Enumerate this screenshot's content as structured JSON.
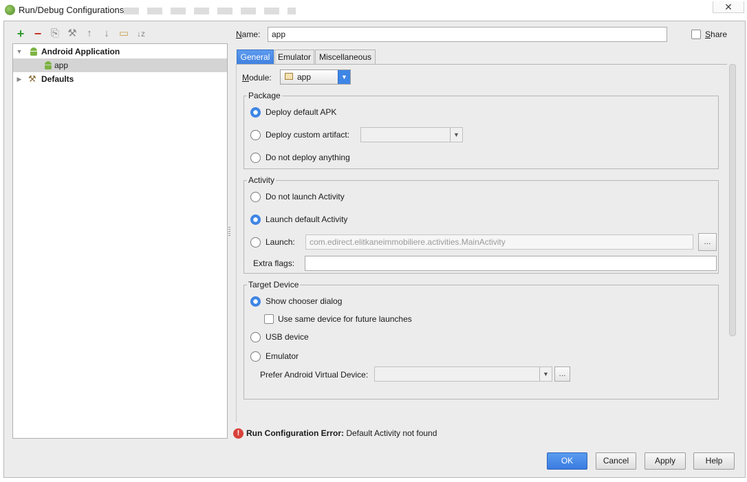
{
  "window": {
    "title": "Run/Debug Configurations",
    "close_glyph": "✕"
  },
  "toolbar": {
    "add": "+",
    "remove": "−",
    "copy": "⎘",
    "edit_defaults": "⚒",
    "move_up": "↑",
    "move_down": "↓",
    "folder": "▭",
    "sort": "↓z"
  },
  "tree": {
    "items": [
      {
        "label": "Android Application",
        "expanded": true,
        "icon": "android-icon"
      },
      {
        "label": "app",
        "icon": "android-icon",
        "selected": true
      },
      {
        "label": "Defaults",
        "expanded": false,
        "icon": "wrench-icon"
      }
    ],
    "expanded_glyph": "▼",
    "collapsed_glyph": "▶"
  },
  "name_field": {
    "label": "Name:",
    "value": "app"
  },
  "share": {
    "label": "Share",
    "checked": false
  },
  "tabs": [
    {
      "label": "General",
      "active": true
    },
    {
      "label": "Emulator",
      "active": false
    },
    {
      "label": "Miscellaneous",
      "active": false
    }
  ],
  "module": {
    "label": "Module:",
    "value": "app",
    "arrow": "▼"
  },
  "package": {
    "title": "Package",
    "options": [
      {
        "label": "Deploy default APK",
        "selected": true
      },
      {
        "label": "Deploy custom artifact:",
        "selected": false
      },
      {
        "label": "Do not deploy anything",
        "selected": false
      }
    ],
    "artifact_value": "",
    "arrow": "▼"
  },
  "activity": {
    "title": "Activity",
    "options": [
      {
        "label": "Do not launch Activity",
        "selected": false
      },
      {
        "label": "Launch default Activity",
        "selected": true
      },
      {
        "label": "Launch:",
        "selected": false
      }
    ],
    "launch_value": "com.edirect.elitkaneimmobiliere.activities.MainActivity",
    "browse_label": "...",
    "extra_flags_label": "Extra flags:",
    "extra_flags_value": ""
  },
  "target_device": {
    "title": "Target Device",
    "options": [
      {
        "label": "Show chooser dialog",
        "selected": true
      },
      {
        "label": "USB device",
        "selected": false
      },
      {
        "label": "Emulator",
        "selected": false
      }
    ],
    "same_device_label": "Use same device for future launches",
    "same_device_checked": false,
    "avd_label": "Prefer Android Virtual Device:",
    "avd_value": "",
    "avd_browse_label": "...",
    "arrow": "▼"
  },
  "error": {
    "icon_glyph": "!",
    "bold": "Run Configuration Error:",
    "message": "Default Activity not found"
  },
  "buttons": {
    "ok": "OK",
    "cancel": "Cancel",
    "apply": "Apply",
    "help": "Help"
  },
  "colors": {
    "accent": "#3e86e6",
    "error": "#d8413a",
    "android_green": "#7cb342"
  }
}
